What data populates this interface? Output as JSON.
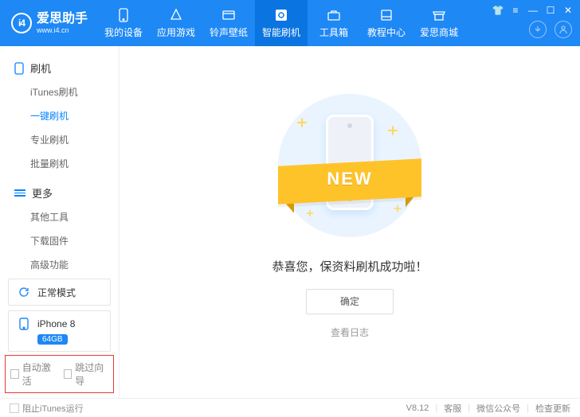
{
  "app": {
    "logo_text": "i4",
    "title": "爱思助手",
    "subtitle": "www.i4.cn"
  },
  "header_tabs": [
    {
      "label": "我的设备",
      "icon": "device"
    },
    {
      "label": "应用游戏",
      "icon": "apps"
    },
    {
      "label": "铃声壁纸",
      "icon": "music"
    },
    {
      "label": "智能刷机",
      "icon": "flash",
      "active": true
    },
    {
      "label": "工具箱",
      "icon": "tools"
    },
    {
      "label": "教程中心",
      "icon": "book"
    },
    {
      "label": "爱思商城",
      "icon": "shop"
    }
  ],
  "header_icons": {
    "download": "download",
    "user": "user"
  },
  "sidebar": {
    "groups": [
      {
        "title": "刷机",
        "items": [
          {
            "label": "iTunes刷机"
          },
          {
            "label": "一键刷机",
            "active": true
          },
          {
            "label": "专业刷机"
          },
          {
            "label": "批量刷机"
          }
        ]
      },
      {
        "title": "更多",
        "items": [
          {
            "label": "其他工具"
          },
          {
            "label": "下载固件"
          },
          {
            "label": "高级功能"
          }
        ]
      }
    ],
    "status": {
      "mode_label": "正常模式",
      "device_name": "iPhone 8",
      "device_storage": "64GB"
    },
    "checkboxes": {
      "auto_activate": "自动激活",
      "skip_wizard": "跳过向导"
    }
  },
  "main": {
    "banner_text": "NEW",
    "success_message": "恭喜您，保资料刷机成功啦！",
    "confirm_button": "确定",
    "view_log": "查看日志"
  },
  "footer": {
    "block_itunes": "阻止iTunes运行",
    "version": "V8.12",
    "support": "客服",
    "wechat": "微信公众号",
    "check_update": "检查更新"
  }
}
